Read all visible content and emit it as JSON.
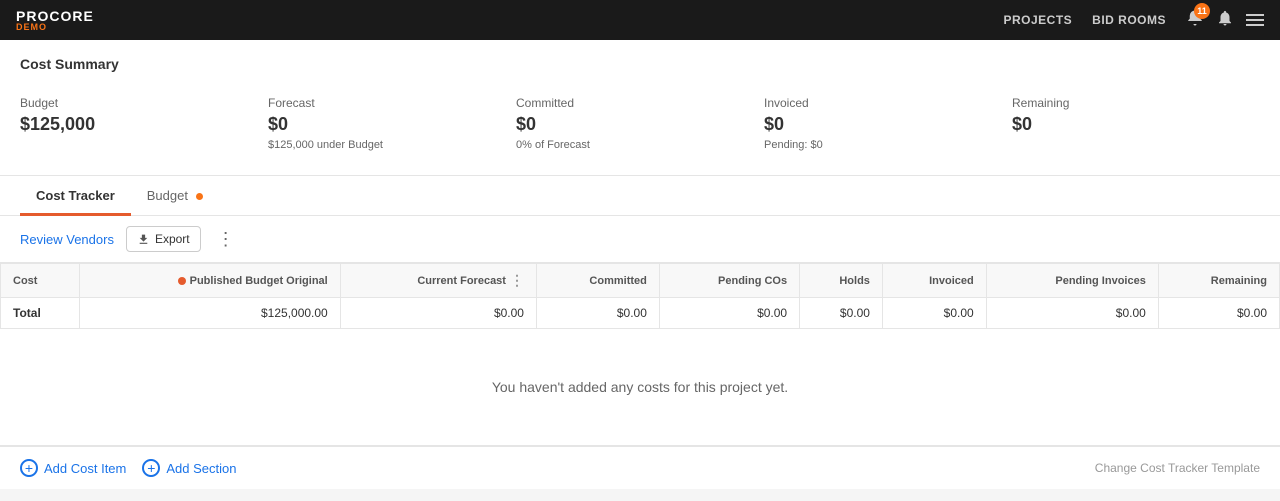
{
  "nav": {
    "logo": "PROCORE",
    "demo": "DEMO",
    "links": [
      "PROJECTS",
      "BID ROOMS"
    ],
    "notification_count": "11"
  },
  "cost_summary": {
    "title": "Cost Summary",
    "cards": [
      {
        "label": "Budget",
        "value": "$125,000",
        "sub": ""
      },
      {
        "label": "Forecast",
        "value": "$0",
        "sub": "$125,000 under Budget"
      },
      {
        "label": "Committed",
        "value": "$0",
        "sub": "0% of Forecast"
      },
      {
        "label": "Invoiced",
        "value": "$0",
        "sub": "Pending: $0"
      },
      {
        "label": "Remaining",
        "value": "$0",
        "sub": ""
      }
    ]
  },
  "tabs": [
    {
      "label": "Cost Tracker",
      "active": true,
      "dot": false
    },
    {
      "label": "Budget",
      "active": false,
      "dot": true
    }
  ],
  "toolbar": {
    "review_vendors_label": "Review Vendors",
    "export_label": "Export",
    "more_label": "⋮"
  },
  "table": {
    "columns": [
      {
        "label": "Cost",
        "align": "left"
      },
      {
        "label": "Published Budget Original",
        "align": "right",
        "has_dot": true
      },
      {
        "label": "Current Forecast",
        "align": "right",
        "has_menu": true
      },
      {
        "label": "Committed",
        "align": "right"
      },
      {
        "label": "Pending COs",
        "align": "right"
      },
      {
        "label": "Holds",
        "align": "right"
      },
      {
        "label": "Invoiced",
        "align": "right"
      },
      {
        "label": "Pending Invoices",
        "align": "right"
      },
      {
        "label": "Remaining",
        "align": "right"
      }
    ],
    "total_row": {
      "label": "Total",
      "values": [
        "$125,000.00",
        "$0.00",
        "$0.00",
        "$0.00",
        "$0.00",
        "$0.00",
        "$0.00",
        "$0.00"
      ]
    },
    "empty_message": "You haven't added any costs for this project yet."
  },
  "footer": {
    "add_cost_item_label": "Add Cost Item",
    "add_section_label": "Add Section",
    "change_template_label": "Change Cost Tracker Template"
  }
}
